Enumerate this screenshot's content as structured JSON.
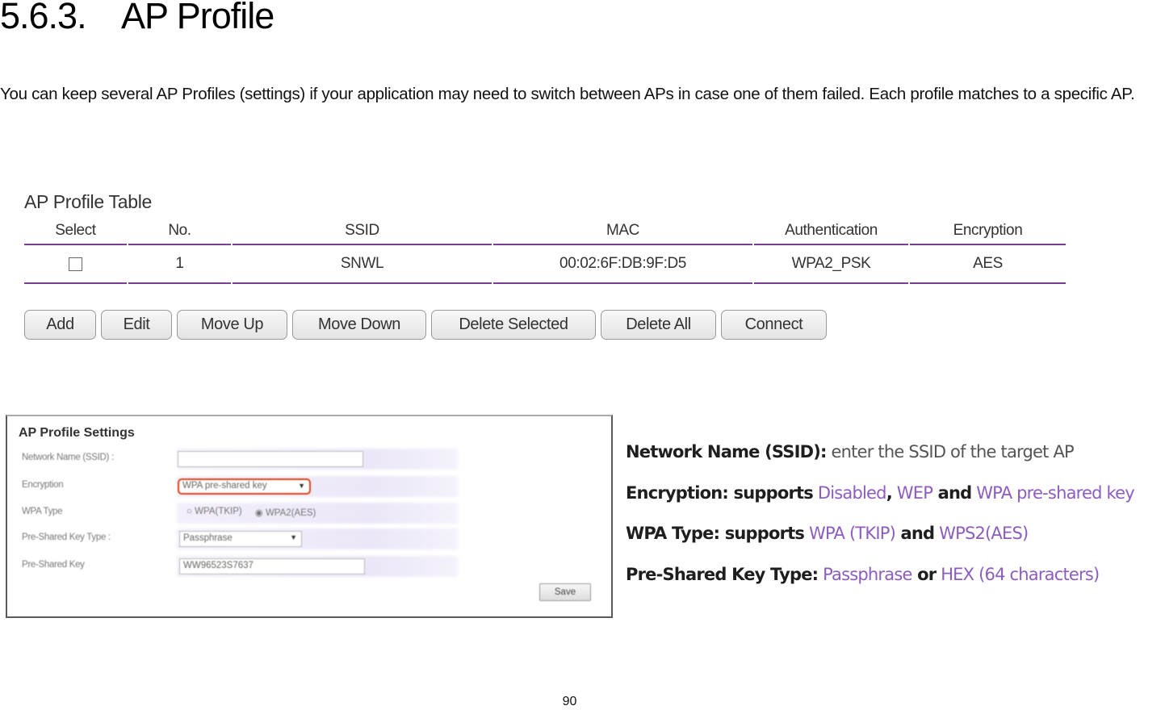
{
  "section": {
    "number": "5.6.3.",
    "title": "AP Profile"
  },
  "paragraph": "You can keep several AP Profiles (settings) if your application may need to switch between APs in case one of them failed. Each profile matches to a specific AP.",
  "ap_profile_table": {
    "title": "AP Profile Table",
    "columns": [
      "Select",
      "No.",
      "SSID",
      "MAC",
      "Authentication",
      "Encryption"
    ],
    "rows": [
      {
        "selected": false,
        "no": "1",
        "ssid": "SNWL",
        "mac": "00:02:6F:DB:9F:D5",
        "authentication": "WPA2_PSK",
        "encryption": "AES"
      }
    ],
    "accent_color": "#7a3d96",
    "buttons": [
      "Add",
      "Edit",
      "Move Up",
      "Move Down",
      "Delete Selected",
      "Delete All",
      "Connect"
    ]
  },
  "ap_profile_settings": {
    "title": "AP Profile Settings",
    "fields": {
      "network_name": {
        "label": "Network Name (SSID) :",
        "value": ""
      },
      "encryption": {
        "label": "Encryption",
        "value": "WPA pre-shared key"
      },
      "wpa_type": {
        "label": "WPA Type",
        "options": [
          "WPA(TKIP)",
          "WPA2(AES)"
        ],
        "selected": "WPA2(AES)"
      },
      "psk_type": {
        "label": "Pre-Shared Key Type :",
        "value": "Passphrase"
      },
      "psk": {
        "label": "Pre-Shared Key",
        "value": "WW96523S7637"
      }
    },
    "save_label": "Save",
    "highlight_color": "#e2431f"
  },
  "notes": [
    {
      "key": "Network Name (SSID):",
      "parts": [
        {
          "t": " enter the SSID of the target AP",
          "c": "d"
        }
      ]
    },
    {
      "key": "Encryption: supports",
      "parts": [
        {
          "t": " Disabled",
          "c": "p"
        },
        {
          "t": ",",
          "c": "k"
        },
        {
          "t": " WEP",
          "c": "p"
        },
        {
          "t": " and",
          "c": "k"
        },
        {
          "t": " WPA pre-shared key",
          "c": "p"
        }
      ]
    },
    {
      "key": "WPA Type: supports",
      "parts": [
        {
          "t": " WPA (TKIP)",
          "c": "p"
        },
        {
          "t": " and",
          "c": "k"
        },
        {
          "t": " WPS2(AES)",
          "c": "p"
        }
      ]
    },
    {
      "key": "Pre-Shared Key Type:",
      "parts": [
        {
          "t": " Passphrase",
          "c": "p"
        },
        {
          "t": " or",
          "c": "k"
        },
        {
          "t": " HEX (64 characters)",
          "c": "p"
        }
      ]
    }
  ],
  "page_number": "90"
}
